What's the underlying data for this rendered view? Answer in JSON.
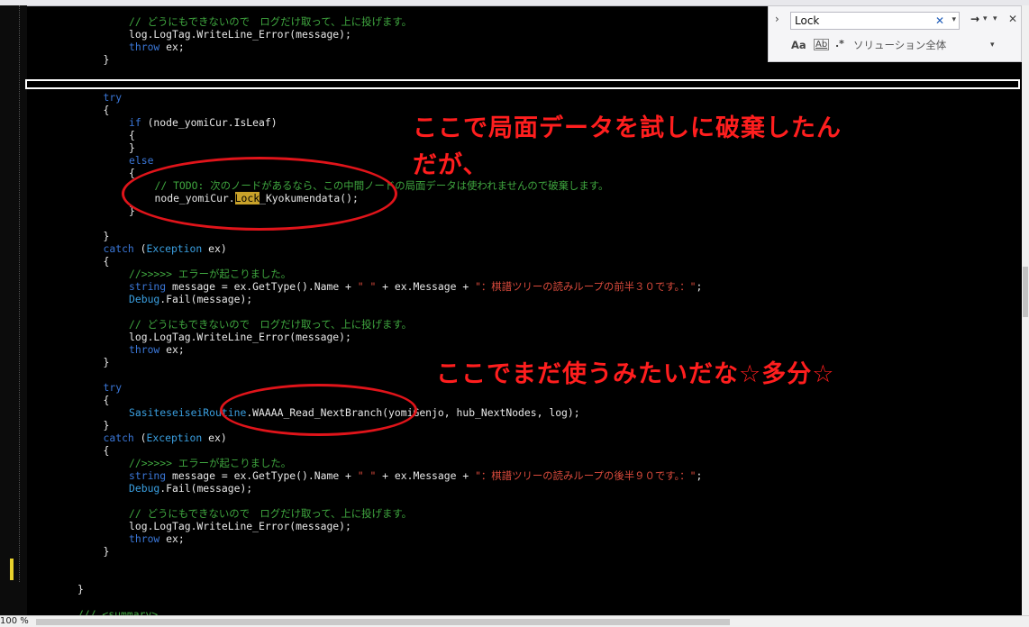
{
  "code_lines": [
    {
      "indent": 4,
      "parts": [
        {
          "t": "c",
          "v": "// どうにもできないので　ログだけ取って、上に投げます。"
        }
      ]
    },
    {
      "indent": 4,
      "parts": [
        {
          "t": "",
          "v": "log.LogTag.WriteLine_Error(message);"
        }
      ]
    },
    {
      "indent": 4,
      "parts": [
        {
          "t": "k",
          "v": "throw"
        },
        {
          "t": "",
          "v": " ex;"
        }
      ]
    },
    {
      "indent": 3,
      "parts": [
        {
          "t": "",
          "v": "}"
        }
      ]
    },
    {
      "indent": 3,
      "parts": [
        {
          "t": "k",
          "v": "try"
        }
      ]
    },
    {
      "indent": 3,
      "parts": [
        {
          "t": "",
          "v": "{"
        }
      ]
    },
    {
      "indent": 4,
      "parts": [
        {
          "t": "k",
          "v": "if"
        },
        {
          "t": "",
          "v": " (node_yomiCur.IsLeaf)"
        }
      ]
    },
    {
      "indent": 4,
      "parts": [
        {
          "t": "",
          "v": "{"
        }
      ]
    },
    {
      "indent": 4,
      "parts": [
        {
          "t": "",
          "v": "}"
        }
      ]
    },
    {
      "indent": 4,
      "parts": [
        {
          "t": "k",
          "v": "else"
        }
      ]
    },
    {
      "indent": 4,
      "parts": [
        {
          "t": "",
          "v": "{"
        }
      ]
    },
    {
      "indent": 5,
      "parts": [
        {
          "t": "c",
          "v": "// TODO: 次のノードがあるなら、この中間ノードの局面データは使われませんので破棄します。"
        }
      ]
    },
    {
      "indent": 5,
      "parts": [
        {
          "t": "",
          "v": "node_yomiCur."
        },
        {
          "t": "hl",
          "v": "Lock"
        },
        {
          "t": "",
          "v": "_Kyokumendata();"
        }
      ]
    },
    {
      "indent": 4,
      "parts": [
        {
          "t": "",
          "v": "}"
        }
      ]
    },
    {
      "indent": 3,
      "parts": [
        {
          "t": "",
          "v": "}"
        }
      ]
    },
    {
      "indent": 3,
      "parts": [
        {
          "t": "k",
          "v": "catch"
        },
        {
          "t": "",
          "v": " ("
        },
        {
          "t": "t",
          "v": "Exception"
        },
        {
          "t": "",
          "v": " ex)"
        }
      ]
    },
    {
      "indent": 3,
      "parts": [
        {
          "t": "",
          "v": "{"
        }
      ]
    },
    {
      "indent": 4,
      "parts": [
        {
          "t": "c",
          "v": "//>>>>> エラーが起こりました。"
        }
      ]
    },
    {
      "indent": 4,
      "parts": [
        {
          "t": "k",
          "v": "string"
        },
        {
          "t": "",
          "v": " message = ex.GetType().Name + "
        },
        {
          "t": "s",
          "v": "\" \""
        },
        {
          "t": "",
          "v": " + ex.Message + "
        },
        {
          "t": "s",
          "v": "\"：棋譜ツリーの読みループの前半３０です。：\""
        },
        {
          "t": "",
          "v": ";"
        }
      ]
    },
    {
      "indent": 4,
      "parts": [
        {
          "t": "t",
          "v": "Debug"
        },
        {
          "t": "",
          "v": ".Fail(message);"
        }
      ]
    },
    {
      "indent": 4,
      "parts": [
        {
          "t": "c",
          "v": "// どうにもできないので　ログだけ取って、上に投げます。"
        }
      ]
    },
    {
      "indent": 4,
      "parts": [
        {
          "t": "",
          "v": "log.LogTag.WriteLine_Error(message);"
        }
      ]
    },
    {
      "indent": 4,
      "parts": [
        {
          "t": "k",
          "v": "throw"
        },
        {
          "t": "",
          "v": " ex;"
        }
      ]
    },
    {
      "indent": 3,
      "parts": [
        {
          "t": "",
          "v": "}"
        }
      ]
    },
    {
      "indent": 3,
      "parts": [
        {
          "t": "k",
          "v": "try"
        }
      ]
    },
    {
      "indent": 3,
      "parts": [
        {
          "t": "",
          "v": "{"
        }
      ]
    },
    {
      "indent": 4,
      "parts": [
        {
          "t": "t",
          "v": "SasiteseiseiRoutine"
        },
        {
          "t": "",
          "v": ".WAAAA_Read_NextBranch(yomiGenjo, hub_NextNodes, log);"
        }
      ]
    },
    {
      "indent": 3,
      "parts": [
        {
          "t": "",
          "v": "}"
        }
      ]
    },
    {
      "indent": 3,
      "parts": [
        {
          "t": "k",
          "v": "catch"
        },
        {
          "t": "",
          "v": " ("
        },
        {
          "t": "t",
          "v": "Exception"
        },
        {
          "t": "",
          "v": " ex)"
        }
      ]
    },
    {
      "indent": 3,
      "parts": [
        {
          "t": "",
          "v": "{"
        }
      ]
    },
    {
      "indent": 4,
      "parts": [
        {
          "t": "c",
          "v": "//>>>>> エラーが起こりました。"
        }
      ]
    },
    {
      "indent": 4,
      "parts": [
        {
          "t": "k",
          "v": "string"
        },
        {
          "t": "",
          "v": " message = ex.GetType().Name + "
        },
        {
          "t": "s",
          "v": "\" \""
        },
        {
          "t": "",
          "v": " + ex.Message + "
        },
        {
          "t": "s",
          "v": "\"：棋譜ツリーの読みループの後半９０です。：\""
        },
        {
          "t": "",
          "v": ";"
        }
      ]
    },
    {
      "indent": 4,
      "parts": [
        {
          "t": "t",
          "v": "Debug"
        },
        {
          "t": "",
          "v": ".Fail(message);"
        }
      ]
    },
    {
      "indent": 4,
      "parts": [
        {
          "t": "c",
          "v": "// どうにもできないので　ログだけ取って、上に投げます。"
        }
      ]
    },
    {
      "indent": 4,
      "parts": [
        {
          "t": "",
          "v": "log.LogTag.WriteLine_Error(message);"
        }
      ]
    },
    {
      "indent": 4,
      "parts": [
        {
          "t": "k",
          "v": "throw"
        },
        {
          "t": "",
          "v": " ex;"
        }
      ]
    },
    {
      "indent": 3,
      "parts": [
        {
          "t": "",
          "v": "}"
        }
      ]
    },
    {
      "indent": 2,
      "parts": [
        {
          "t": "",
          "v": "}"
        }
      ]
    },
    {
      "indent": 2,
      "parts": [
        {
          "t": "c",
          "v": "/// <summary>"
        }
      ]
    }
  ],
  "annotations": {
    "note1_line1": "ここで局面データを試しに破棄したん",
    "note1_line2": "だが、",
    "note2": "ここでまだ使うみたいだな☆多分☆"
  },
  "find": {
    "query": "Lock",
    "scope": "ソリューション全体",
    "match_case_label": "Aa",
    "whole_word_label": "Ab"
  },
  "status": {
    "zoom": "100 %"
  },
  "colors": {
    "annotation": "#ff1e1e",
    "ellipse": "#e0141a",
    "highlight": "#c9a22a"
  }
}
